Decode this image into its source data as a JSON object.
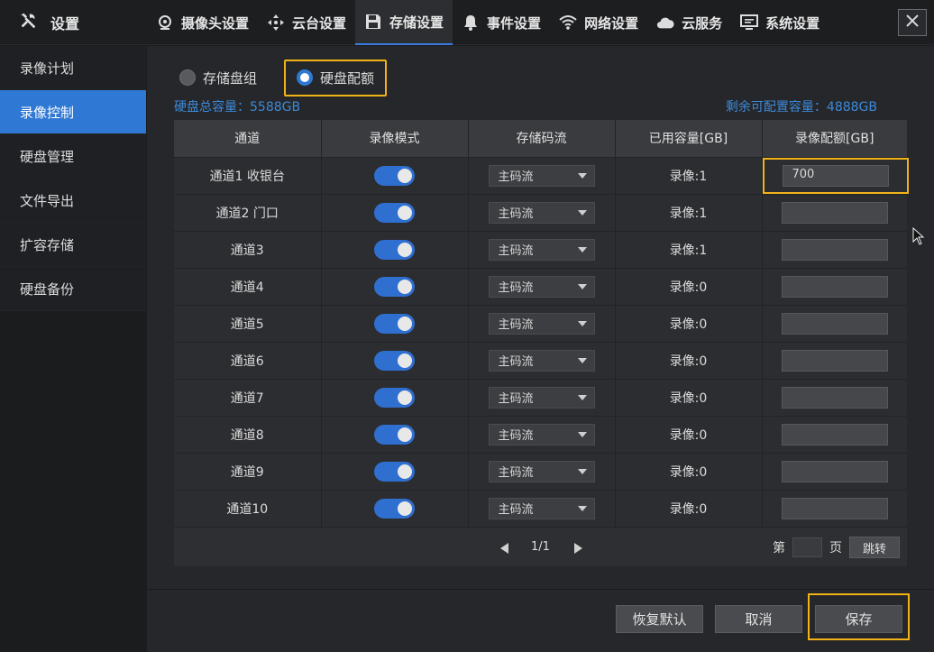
{
  "app": {
    "title": "设置",
    "icon": "wrench-screwdriver-icon"
  },
  "tabs": [
    {
      "label": "摄像头设置",
      "icon": "camera-icon",
      "active": false
    },
    {
      "label": "云台设置",
      "icon": "ptz-arrows-icon",
      "active": false
    },
    {
      "label": "存储设置",
      "icon": "floppy-disk-icon",
      "active": true
    },
    {
      "label": "事件设置",
      "icon": "bell-icon",
      "active": false
    },
    {
      "label": "网络设置",
      "icon": "wifi-icon",
      "active": false
    },
    {
      "label": "云服务",
      "icon": "cloud-icon",
      "active": false
    },
    {
      "label": "系统设置",
      "icon": "monitor-icon",
      "active": false
    }
  ],
  "sidebar": {
    "items": [
      {
        "label": "录像计划",
        "active": false
      },
      {
        "label": "录像控制",
        "active": true
      },
      {
        "label": "硬盘管理",
        "active": false
      },
      {
        "label": "文件导出",
        "active": false
      },
      {
        "label": "扩容存储",
        "active": false
      },
      {
        "label": "硬盘备份",
        "active": false
      }
    ]
  },
  "mode": {
    "option_group": "存储盘组",
    "option_quota": "硬盘配额",
    "selected": "硬盘配额"
  },
  "capacity": {
    "total": "硬盘总容量：5588GB",
    "remaining": "剩余可配置容量：4888GB"
  },
  "table": {
    "headers": [
      "通道",
      "录像模式",
      "存储码流",
      "已用容量[GB]",
      "录像配额[GB]"
    ],
    "rows": [
      {
        "channel": "通道1 收银台",
        "mode_on": true,
        "stream": "主码流",
        "used": "录像:1",
        "quota": "700"
      },
      {
        "channel": "通道2 门口",
        "mode_on": true,
        "stream": "主码流",
        "used": "录像:1",
        "quota": ""
      },
      {
        "channel": "通道3",
        "mode_on": true,
        "stream": "主码流",
        "used": "录像:1",
        "quota": ""
      },
      {
        "channel": "通道4",
        "mode_on": true,
        "stream": "主码流",
        "used": "录像:0",
        "quota": ""
      },
      {
        "channel": "通道5",
        "mode_on": true,
        "stream": "主码流",
        "used": "录像:0",
        "quota": ""
      },
      {
        "channel": "通道6",
        "mode_on": true,
        "stream": "主码流",
        "used": "录像:0",
        "quota": ""
      },
      {
        "channel": "通道7",
        "mode_on": true,
        "stream": "主码流",
        "used": "录像:0",
        "quota": ""
      },
      {
        "channel": "通道8",
        "mode_on": true,
        "stream": "主码流",
        "used": "录像:0",
        "quota": ""
      },
      {
        "channel": "通道9",
        "mode_on": true,
        "stream": "主码流",
        "used": "录像:0",
        "quota": ""
      },
      {
        "channel": "通道10",
        "mode_on": true,
        "stream": "主码流",
        "used": "录像:0",
        "quota": ""
      }
    ]
  },
  "pager": {
    "page": "1/1",
    "goto_prefix": "第",
    "goto_suffix": "页",
    "jump_label": "跳转"
  },
  "buttons": {
    "restore_default": "恢复默认",
    "cancel": "取消",
    "save": "保存"
  },
  "colors": {
    "accent": "#2f79d4",
    "highlight": "#f2b317",
    "caption": "#3c8ad9"
  }
}
